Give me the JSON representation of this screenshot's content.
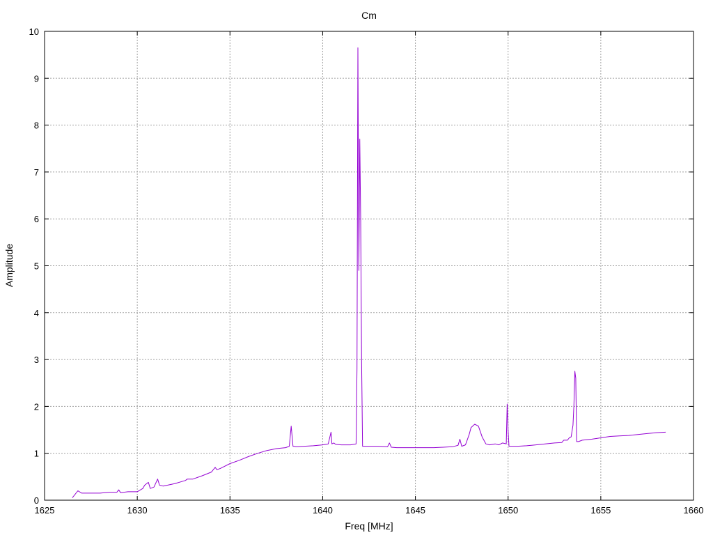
{
  "chart_data": {
    "type": "line",
    "title": "Cm",
    "xlabel": "Freq [MHz]",
    "ylabel": "Amplitude",
    "xlim": [
      1625,
      1660
    ],
    "ylim": [
      0,
      10
    ],
    "x_ticks": [
      1625,
      1630,
      1635,
      1640,
      1645,
      1650,
      1655,
      1660
    ],
    "y_ticks": [
      0,
      1,
      2,
      3,
      4,
      5,
      6,
      7,
      8,
      9,
      10
    ],
    "grid": true,
    "legend": "none",
    "series_color": "#9400d3",
    "series": [
      {
        "x": [
          1626.5,
          1626.8,
          1627.0,
          1627.5,
          1628.0,
          1628.5,
          1628.9,
          1629.0,
          1629.1,
          1629.5,
          1630.0,
          1630.3,
          1630.4,
          1630.5,
          1630.6,
          1630.7,
          1630.9,
          1631.1,
          1631.2,
          1631.4,
          1632.0,
          1632.6,
          1632.7,
          1633.0,
          1633.5,
          1634.0,
          1634.2,
          1634.3,
          1634.5,
          1635.0,
          1635.5,
          1636.0,
          1636.5,
          1637.0,
          1637.5,
          1638.0,
          1638.2,
          1638.3,
          1638.4,
          1638.6,
          1639.0,
          1639.5,
          1640.0,
          1640.3,
          1640.45,
          1640.5,
          1640.6,
          1640.7,
          1641.0,
          1641.5,
          1641.8,
          1641.85,
          1641.9,
          1641.95,
          1642.0,
          1642.05,
          1642.1,
          1642.15,
          1642.3,
          1642.5,
          1643.0,
          1643.5,
          1643.6,
          1643.7,
          1644.0,
          1645.0,
          1646.0,
          1646.5,
          1647.0,
          1647.3,
          1647.4,
          1647.5,
          1647.7,
          1647.9,
          1648.0,
          1648.2,
          1648.4,
          1648.6,
          1648.8,
          1649.0,
          1649.3,
          1649.5,
          1649.7,
          1649.9,
          1649.95,
          1650.0,
          1650.05,
          1650.2,
          1650.5,
          1651.0,
          1651.5,
          1652.0,
          1652.5,
          1652.9,
          1653.0,
          1653.2,
          1653.3,
          1653.4,
          1653.5,
          1653.55,
          1653.6,
          1653.65,
          1653.7,
          1653.8,
          1654.0,
          1654.5,
          1655.0,
          1655.5,
          1656.0,
          1656.5,
          1657.0,
          1657.5,
          1658.0,
          1658.5
        ],
        "y": [
          0.05,
          0.2,
          0.15,
          0.15,
          0.15,
          0.17,
          0.17,
          0.22,
          0.16,
          0.18,
          0.18,
          0.25,
          0.32,
          0.35,
          0.38,
          0.25,
          0.28,
          0.45,
          0.32,
          0.3,
          0.35,
          0.42,
          0.45,
          0.45,
          0.52,
          0.6,
          0.7,
          0.65,
          0.68,
          0.78,
          0.85,
          0.93,
          1.0,
          1.06,
          1.1,
          1.12,
          1.15,
          1.58,
          1.15,
          1.14,
          1.15,
          1.16,
          1.18,
          1.2,
          1.45,
          1.2,
          1.22,
          1.19,
          1.18,
          1.18,
          1.2,
          2.8,
          9.65,
          4.9,
          7.7,
          6.0,
          3.0,
          1.15,
          1.15,
          1.15,
          1.15,
          1.14,
          1.22,
          1.13,
          1.12,
          1.12,
          1.12,
          1.13,
          1.14,
          1.17,
          1.3,
          1.15,
          1.18,
          1.4,
          1.55,
          1.62,
          1.58,
          1.35,
          1.2,
          1.18,
          1.2,
          1.18,
          1.22,
          1.2,
          2.05,
          1.5,
          1.15,
          1.15,
          1.15,
          1.16,
          1.18,
          1.2,
          1.22,
          1.23,
          1.28,
          1.28,
          1.33,
          1.35,
          1.6,
          2.0,
          2.75,
          2.6,
          1.25,
          1.25,
          1.28,
          1.3,
          1.33,
          1.36,
          1.37,
          1.38,
          1.4,
          1.42,
          1.44,
          1.45
        ]
      }
    ]
  }
}
